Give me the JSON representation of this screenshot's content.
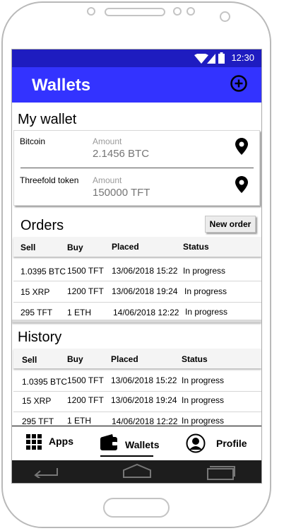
{
  "status_bar": {
    "time": "12:30"
  },
  "app_bar": {
    "title": "Wallets",
    "add_icon": "add-circle-icon"
  },
  "my_wallet": {
    "title": "My wallet",
    "items": [
      {
        "name": "Bitcoin",
        "amount_label": "Amount",
        "amount_placeholder": "2.1456 BTC",
        "icon": "location-pin-icon"
      },
      {
        "name": "Threefold token",
        "amount_label": "Amount",
        "amount_placeholder": "150000 TFT",
        "icon": "location-pin-icon"
      }
    ]
  },
  "orders": {
    "title": "Orders",
    "new_order_label": "New order",
    "columns": [
      "Sell",
      "Buy",
      "Placed",
      "Status"
    ],
    "rows": [
      [
        "1.0395 BTC",
        "1500 TFT",
        "13/06/2018 15:22",
        "In progress"
      ],
      [
        "15 XRP",
        "1200 TFT",
        "13/06/2018 19:24",
        "In progress"
      ],
      [
        "295 TFT",
        "1 ETH",
        "14/06/2018 12:22",
        "In progress"
      ]
    ]
  },
  "history": {
    "title": "History",
    "columns": [
      "Sell",
      "Buy",
      "Placed",
      "Status"
    ],
    "rows": [
      [
        "1.0395 BTC",
        "1500 TFT",
        "13/06/2018 15:22",
        "In progress"
      ],
      [
        "15 XRP",
        "1200 TFT",
        "13/06/2018 19:24",
        "In progress"
      ],
      [
        "295 TFT",
        "1 ETH",
        "14/06/2018 12:22",
        "In progress"
      ]
    ]
  },
  "bottom_nav": {
    "items": [
      {
        "label": "Apps",
        "icon": "apps-grid-icon"
      },
      {
        "label": "Wallets",
        "icon": "wallet-icon",
        "active": true
      },
      {
        "label": "Profile",
        "icon": "profile-icon"
      }
    ]
  },
  "system_nav": {
    "icons": [
      "back-icon",
      "home-icon",
      "recents-icon"
    ]
  },
  "colors": {
    "status_bar": "#1e1cc0",
    "app_bar": "#3333ff",
    "system_bar": "#1d1d1d"
  }
}
